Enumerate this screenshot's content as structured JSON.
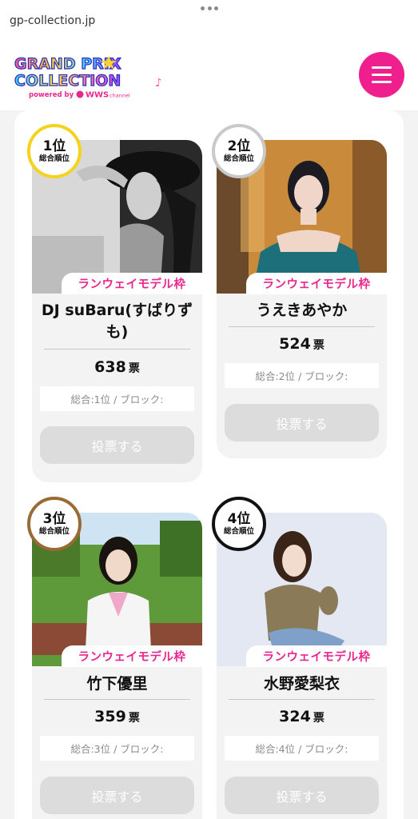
{
  "browser": {
    "url": "gp-collection.jp"
  },
  "header": {
    "logo_line1": "GRAND PRIX",
    "logo_line2": "COLLECTION",
    "logo_powered": "powered by",
    "logo_channel": "WWS",
    "logo_channel_sub": "channel"
  },
  "colors": {
    "accent": "#ef1f8d",
    "tag_text": "#e8278d",
    "button_disabled": "#dcdcdc"
  },
  "candidates": [
    {
      "rank": "1位",
      "rank_label": "総合順位",
      "badge_color": "#f5d31c",
      "frame": "ランウェイモデル枠",
      "name": "DJ suBaru(すばりずも)",
      "votes": "638",
      "votes_unit": "票",
      "rank_info": "総合:1位 / ブロック:",
      "vote_button": "投票する"
    },
    {
      "rank": "2位",
      "rank_label": "総合順位",
      "badge_color": "#c9c9c9",
      "frame": "ランウェイモデル枠",
      "name": "うえきあやか",
      "votes": "524",
      "votes_unit": "票",
      "rank_info": "総合:2位 / ブロック:",
      "vote_button": "投票する"
    },
    {
      "rank": "3位",
      "rank_label": "総合順位",
      "badge_color": "#9a6a34",
      "frame": "ランウェイモデル枠",
      "name": "竹下優里",
      "votes": "359",
      "votes_unit": "票",
      "rank_info": "総合:3位 / ブロック:",
      "vote_button": "投票する"
    },
    {
      "rank": "4位",
      "rank_label": "総合順位",
      "badge_color": "#111111",
      "frame": "ランウェイモデル枠",
      "name": "水野愛梨衣",
      "votes": "324",
      "votes_unit": "票",
      "rank_info": "総合:4位 / ブロック:",
      "vote_button": "投票する"
    }
  ]
}
